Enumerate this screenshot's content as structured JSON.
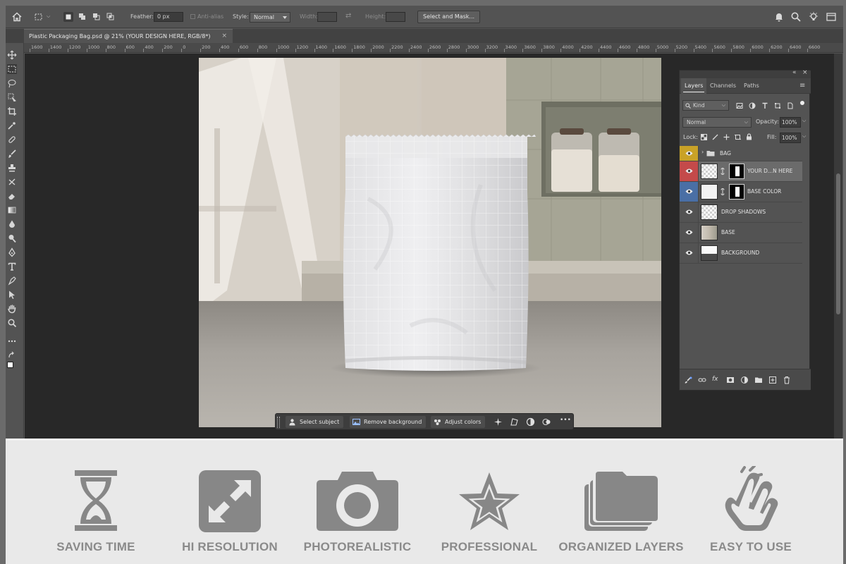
{
  "options_bar": {
    "feather_label": "Feather:",
    "feather_value": "0 px",
    "antialias_label": "Anti-alias",
    "style_label": "Style:",
    "style_value": "Normal",
    "width_label": "Width:",
    "height_label": "Height:",
    "select_mask_label": "Select and Mask..."
  },
  "document_tab": {
    "title": "Plastic Packaging Bag.psd @ 21% (YOUR DESIGN HERE, RGB/8*)",
    "close": "×"
  },
  "ruler": {
    "labels": [
      "1600",
      "1400",
      "1200",
      "1000",
      "800",
      "600",
      "400",
      "200",
      "0",
      "200",
      "400",
      "600",
      "800",
      "1000",
      "1200",
      "1400",
      "1600",
      "1800",
      "2000",
      "2200",
      "2400",
      "2600",
      "2800",
      "3000",
      "3200",
      "3400",
      "3600",
      "3800",
      "4000",
      "4200",
      "4400",
      "4600",
      "4800",
      "5000",
      "5200",
      "5400",
      "5600",
      "5800",
      "6000",
      "6200",
      "6400",
      "6600"
    ]
  },
  "taskbar": {
    "select_subject": "Select subject",
    "remove_background": "Remove background",
    "adjust_colors": "Adjust colors",
    "more": "•••"
  },
  "layers_panel": {
    "collapse_glyph": "«",
    "close_glyph": "×",
    "menu_glyph": "≡",
    "tabs": [
      "Layers",
      "Channels",
      "Paths"
    ],
    "filter_kind": "Kind",
    "blend_mode": "Normal",
    "opacity_label": "Opacity:",
    "opacity_value": "100%",
    "lock_label": "Lock:",
    "fill_label": "Fill:",
    "fill_value": "100%",
    "group_name": "BAG",
    "layers": [
      {
        "name": "YOUR D...N HERE",
        "eye_color": "#c44a4a"
      },
      {
        "name": "BASE COLOR",
        "eye_color": "#4a6fa5"
      },
      {
        "name": "DROP SHADOWS"
      },
      {
        "name": "BASE"
      },
      {
        "name": "BACKGROUND"
      }
    ],
    "group_eye_color": "#c9a227"
  },
  "features": [
    {
      "label": "SAVING TIME",
      "icon": "hourglass-icon"
    },
    {
      "label": "HI RESOLUTION",
      "icon": "expand-arrows-icon"
    },
    {
      "label": "PHOTOREALISTIC",
      "icon": "camera-icon"
    },
    {
      "label": "PROFESSIONAL",
      "icon": "star-icon"
    },
    {
      "label": "ORGANIZED LAYERS",
      "icon": "stacked-folders-icon"
    },
    {
      "label": "EASY TO USE",
      "icon": "tap-hand-icon"
    }
  ]
}
